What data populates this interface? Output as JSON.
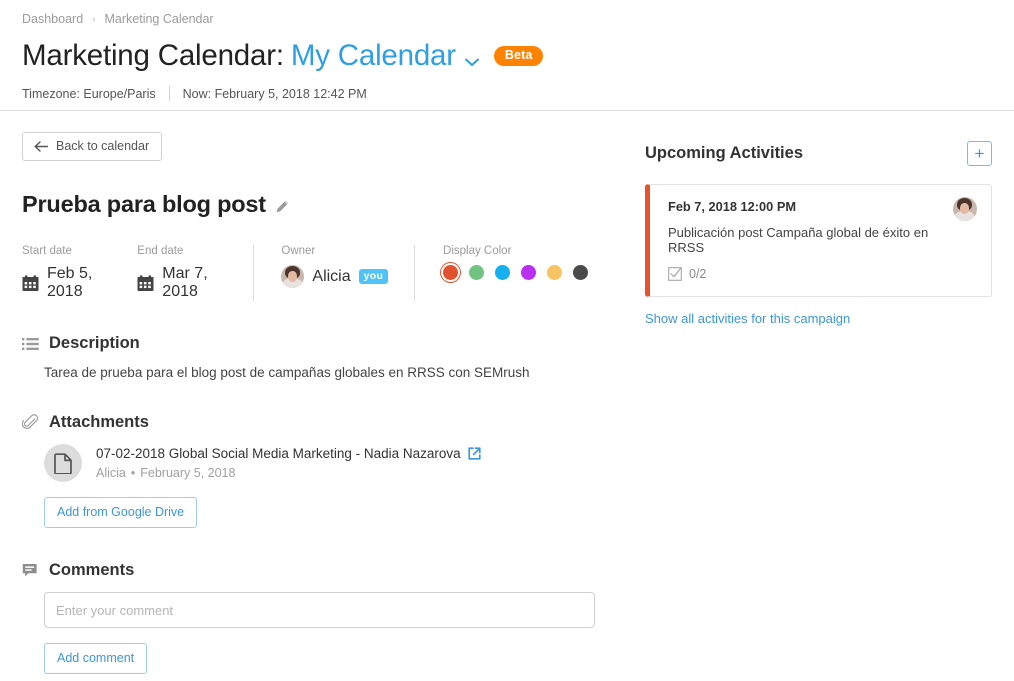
{
  "header": {
    "breadcrumb": [
      {
        "label": "Dashboard",
        "name": "breadcrumb-dashboard"
      },
      {
        "label": "Marketing Calendar",
        "name": "breadcrumb-marketing-calendar"
      }
    ],
    "breadcrumb_separator": "›",
    "title_prefix": "Marketing Calendar:",
    "calendar_name": "My Calendar",
    "caret": "⌄",
    "beta_label": "Beta",
    "timezone": "Timezone: Europe/Paris",
    "now": "Now: February 5, 2018 12:42 PM"
  },
  "toolbar": {
    "back_label": "Back to calendar",
    "back_arrow": "←"
  },
  "campaign": {
    "title": "Prueba para blog post",
    "edit_icon": "pencil-icon"
  },
  "meta": {
    "start": {
      "label": "Start date",
      "value": "Feb 5, 2018"
    },
    "end": {
      "label": "End date",
      "value": "Mar 7, 2018"
    },
    "owner": {
      "label": "Owner",
      "name": "Alicia",
      "badge": "you"
    },
    "color": {
      "label": "Display Color",
      "swatches": [
        {
          "hex": "#e0522f",
          "selected": true
        },
        {
          "hex": "#72c282",
          "selected": false
        },
        {
          "hex": "#16b0ef",
          "selected": false
        },
        {
          "hex": "#bb2ff0",
          "selected": false
        },
        {
          "hex": "#f8c463",
          "selected": false
        },
        {
          "hex": "#4a4a4a",
          "selected": false
        }
      ]
    }
  },
  "description": {
    "title": "Description",
    "text": "Tarea de prueba para el blog post de campañas globales en RRSS con SEMrush"
  },
  "attachments": {
    "title": "Attachments",
    "items": [
      {
        "name": "07-02-2018 Global Social Media Marketing - Nadia Nazarova",
        "author": "Alicia",
        "separator": "•",
        "date": "February 5, 2018"
      }
    ],
    "add_label": "Add from Google Drive"
  },
  "comments": {
    "title": "Comments",
    "placeholder": "Enter your comment",
    "value": "",
    "add_label": "Add comment"
  },
  "upcoming": {
    "title": "Upcoming Activities",
    "add_label": "+",
    "accent_color": "#e8502e",
    "activities": [
      {
        "time": "Feb 7, 2018 12:00 PM",
        "text": "Publicación post Campaña global de éxito en RRSS",
        "checklist": "0/2"
      }
    ],
    "show_all_label": "Show all activities for this campaign"
  }
}
